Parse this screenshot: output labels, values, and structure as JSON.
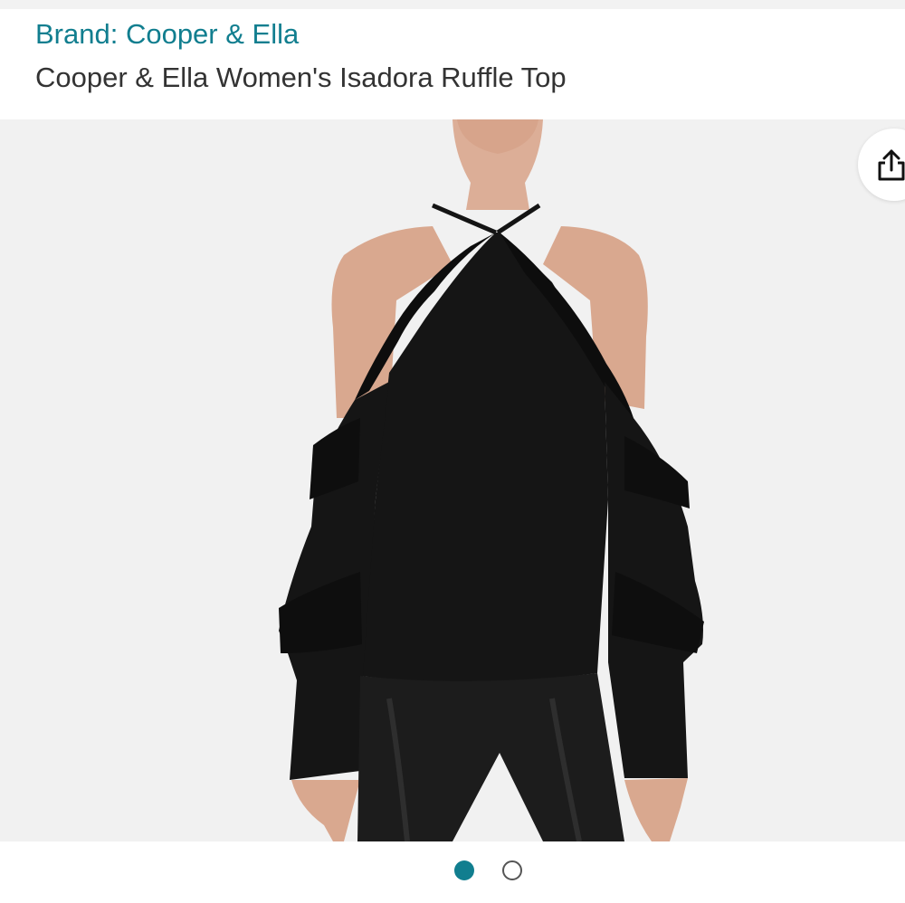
{
  "header": {
    "brand_link": "Brand: Cooper & Ella",
    "product_title": "Cooper & Ella Women's Isadora Ruffle Top"
  },
  "gallery": {
    "image_description_icon": "product-photo",
    "share_icon": "share-icon",
    "image_count": 2,
    "current_image": 1
  },
  "colors": {
    "brand_link": "#117e8f",
    "title_text": "#333333",
    "active_dot": "#117e8f",
    "gallery_background": "#f1f1f1"
  }
}
